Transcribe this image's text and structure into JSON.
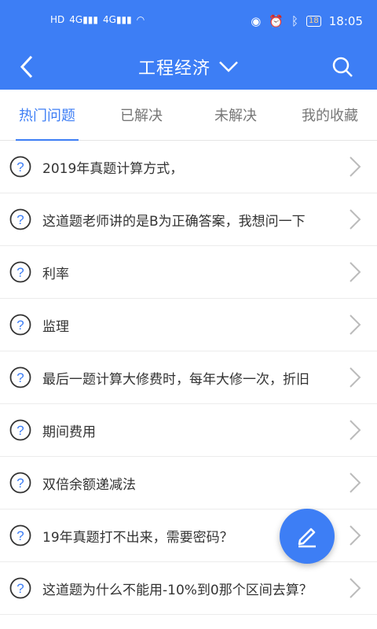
{
  "statusbar": {
    "left_indicators": [
      "HD",
      "4G",
      "4G",
      "wifi"
    ],
    "battery": "18",
    "time": "18:05"
  },
  "header": {
    "title": "工程经济",
    "back_icon": "chevron-left-icon",
    "dropdown_icon": "chevron-down-icon",
    "search_icon": "search-icon"
  },
  "tabs": [
    {
      "label": "热门问题",
      "active": true
    },
    {
      "label": "已解决",
      "active": false
    },
    {
      "label": "未解决",
      "active": false
    },
    {
      "label": "我的收藏",
      "active": false
    }
  ],
  "questions": [
    "2019年真题计算方式，",
    "这道题老师讲的是B为正确答案，我想问一下",
    "利率",
    "监理",
    "最后一题计算大修费时，每年大修一次，折旧",
    "期间费用",
    "双倍余额递减法",
    "19年真题打不出来，需要密码？",
    "这道题为什么不能用-10%到0那个区间去算？"
  ],
  "fab_icon": "edit-pencil-icon",
  "colors": {
    "accent": "#3d7ef5",
    "text": "#333333",
    "tab_inactive": "#777777"
  }
}
